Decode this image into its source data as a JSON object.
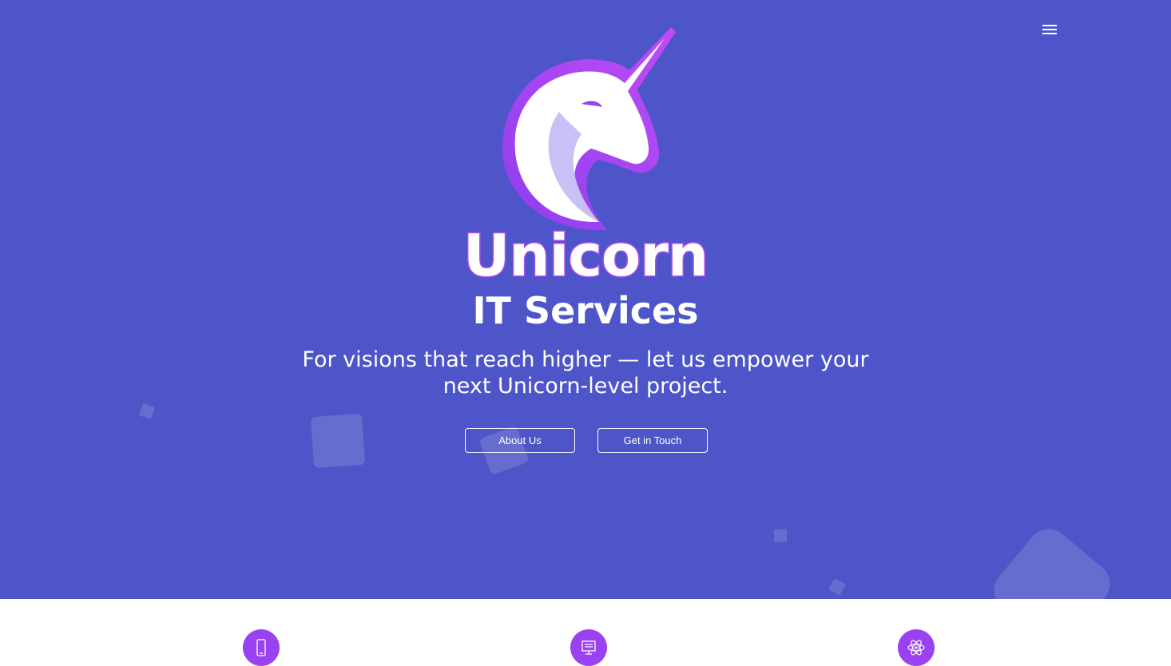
{
  "hero": {
    "brand": "Unicorn",
    "subtitle": "IT Services",
    "tagline_line1": "For visions that reach higher — let us empower your",
    "tagline_line2": "next Unicorn-level project."
  },
  "buttons": {
    "about_label": "About Us",
    "contact_label": "Get in Touch"
  },
  "nav": {
    "menu_icon": "hamburger-menu-icon"
  },
  "services": {
    "icons": [
      "mobile-phone-icon",
      "presentation-board-icon",
      "atom-icon"
    ]
  },
  "colors": {
    "hero_background": "#4e55c8",
    "accent_purple": "#9a42f0",
    "brand_outline": "#b24cf2",
    "text": "#ffffff"
  }
}
